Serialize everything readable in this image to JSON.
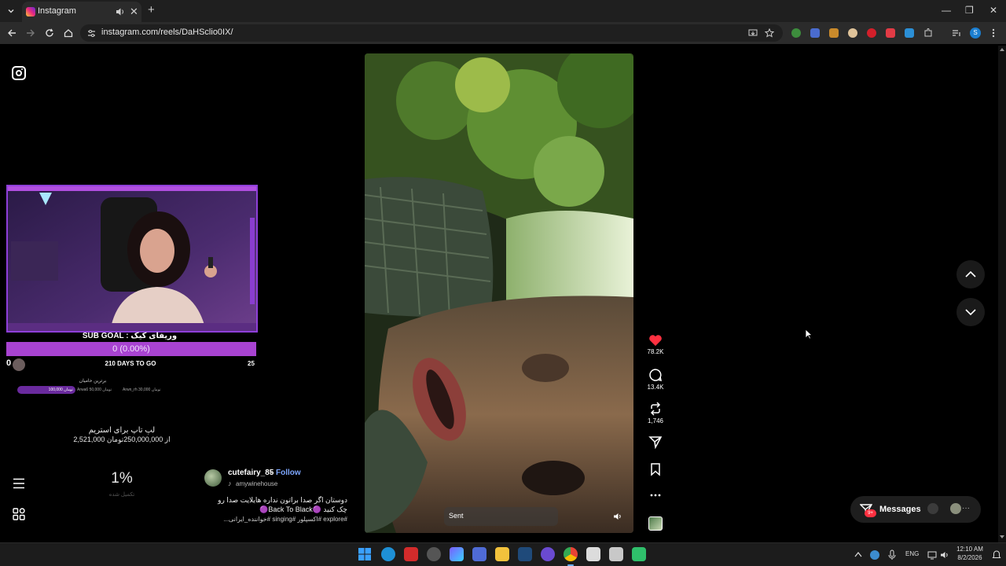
{
  "browser": {
    "tab_title": "Instagram",
    "tab_close": "✕",
    "new_tab": "+",
    "url": "instagram.com/reels/DaHSclio0IX/",
    "window_minimize": "—",
    "window_restore": "❐",
    "window_close": "✕"
  },
  "streamer": {
    "sub_goal_label": "SUB GOAL : وریفای کیک",
    "sub_goal_value": "0 (0.00%)",
    "sub_goal_start": "0",
    "days_to_go": "210 DAYS TO GO",
    "sub_goal_end": "25",
    "top_donors_title": "برترین حامیان",
    "donor_1": "100,000 تومان",
    "donor_2": "Arwa6 تومان 50,000",
    "donor_3": "Arwn_rh تومان 30,000",
    "laptop_title": "لپ تاپ برای استریم",
    "laptop_progress": "2,521,000 از 250,000,000تومان",
    "percent": "1%",
    "percent_sub": "تکمیل شده"
  },
  "reel": {
    "author": "cutefairy_85",
    "follow_separator": "•",
    "follow_label": "Follow",
    "audio_icon": "♪",
    "audio": "amywinehouse",
    "caption_line1": "دوستان اگر صدا براتون نداره هایلایت صدا رو",
    "caption_line2": "چک کنید 🟣Back To Black🟣",
    "caption_line3": "#explore #اکسپلور #singing #خواننده_ایرانی...",
    "sent_label": "Sent",
    "likes": "78.2K",
    "comments": "13.4K",
    "reposts": "1,746",
    "like_color": "#ff3040"
  },
  "messages": {
    "label": "Messages",
    "badge": "9+",
    "more": "···"
  },
  "taskbar": {
    "language": "ENG",
    "time": "12:10 AM",
    "date": "8/2/2026"
  },
  "icons": {
    "nav_up": "chevron-up-icon",
    "nav_down": "chevron-down-icon",
    "menu": "hamburger-icon",
    "more": "grid-icon"
  }
}
